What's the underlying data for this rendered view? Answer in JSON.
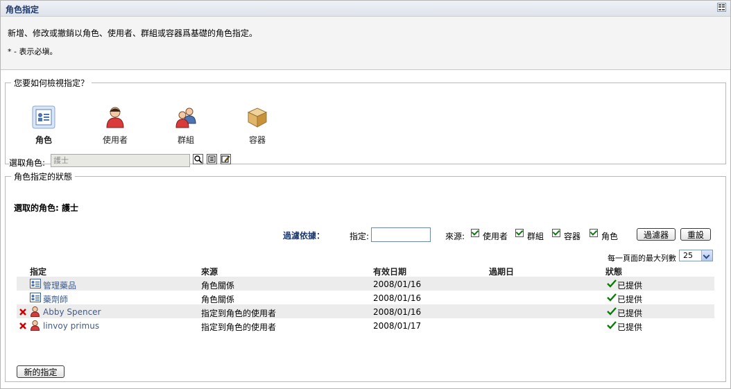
{
  "header": {
    "title": "角色指定"
  },
  "intro": {
    "description": "新增、修改或撤銷以角色、使用者、群組或容器爲基礎的角色指定。",
    "required_note": "* - 表示必塡。"
  },
  "view_group": {
    "legend": "您要如何檢視指定？",
    "options": [
      {
        "label": "角色",
        "icon": "role-icon",
        "selected": true
      },
      {
        "label": "使用者",
        "icon": "user-icon",
        "selected": false
      },
      {
        "label": "群組",
        "icon": "group-icon",
        "selected": false
      },
      {
        "label": "容器",
        "icon": "container-icon",
        "selected": false
      }
    ],
    "select_label": "選取角色:",
    "select_value": "護士"
  },
  "status_group": {
    "legend": "角色指定的狀態",
    "selected_role_label": "選取的角色: 護士",
    "filter_by": "過濾依據：",
    "assignment_label": "指定:",
    "assignment_value": "",
    "source_label": "來源:",
    "sources": [
      {
        "label": "使用者",
        "checked": true
      },
      {
        "label": "群組",
        "checked": true
      },
      {
        "label": "容器",
        "checked": true
      },
      {
        "label": "角色",
        "checked": true
      }
    ],
    "filter_button": "過濾器",
    "reset_button": "重設",
    "max_rows_label": "每一頁面的最大列數",
    "max_rows_value": "25",
    "columns": [
      "指定",
      "來源",
      "有效日期",
      "過期日",
      "狀態"
    ],
    "rows": [
      {
        "icon": "role-icon",
        "removable": false,
        "assignment": "管理藥品",
        "source": "角色關係",
        "effective": "2008/01/16",
        "expiry": "",
        "status": "已提供"
      },
      {
        "icon": "role-icon",
        "removable": false,
        "assignment": "藥劑師",
        "source": "角色關係",
        "effective": "2008/01/16",
        "expiry": "",
        "status": "已提供"
      },
      {
        "icon": "user-icon",
        "removable": true,
        "assignment": "Abby Spencer",
        "source": "指定到角色的使用者",
        "effective": "2008/01/16",
        "expiry": "",
        "status": "已提供"
      },
      {
        "icon": "user-icon",
        "removable": true,
        "assignment": "linvoy primus",
        "source": "指定到角色的使用者",
        "effective": "2008/01/17",
        "expiry": "",
        "status": "已提供"
      }
    ],
    "new_button": "新的指定"
  },
  "colors": {
    "title": "#1f3a6b",
    "link": "#3e5c8c",
    "check": "#0a7a0a",
    "remove": "#cc0000"
  }
}
